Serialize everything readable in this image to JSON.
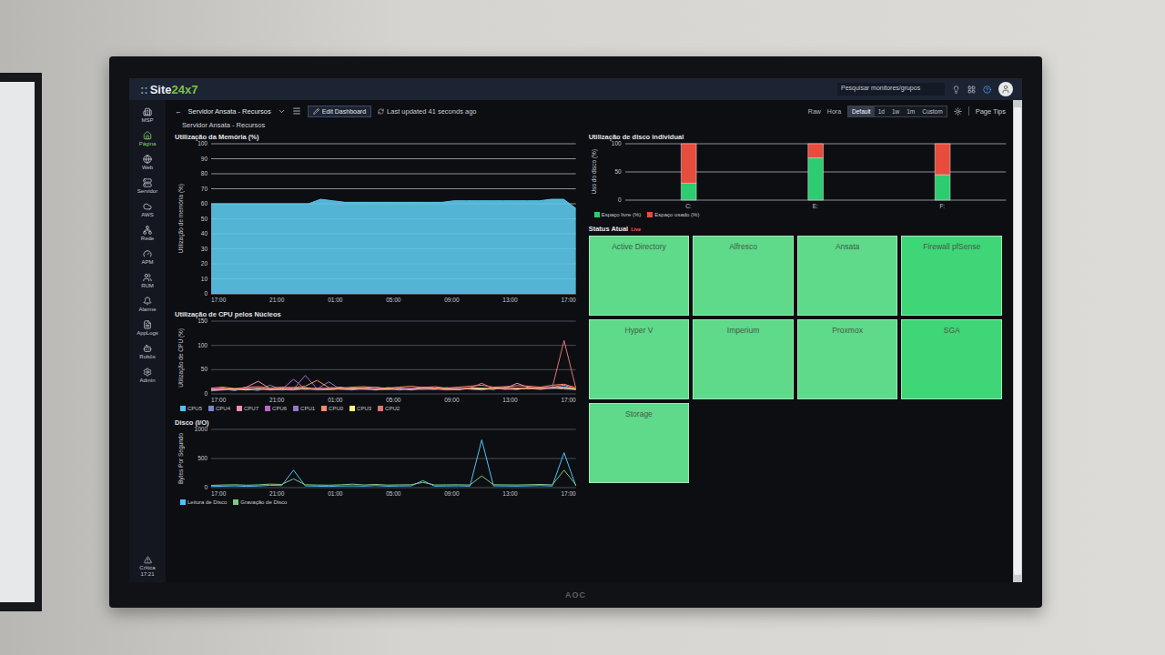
{
  "monitor": {
    "brand": "AOC"
  },
  "topbar": {
    "logo_mark": "::",
    "logo_prefix": "Site",
    "logo_suffix": "24x7",
    "search": {
      "placeholder": "Pesquisar monitores/grupos"
    }
  },
  "sidebar": {
    "items": [
      {
        "label": "MSP",
        "selected": false
      },
      {
        "label": "Página",
        "selected": true
      },
      {
        "label": "Web",
        "selected": false
      },
      {
        "label": "Servidor",
        "selected": false
      },
      {
        "label": "AWS",
        "selected": false
      },
      {
        "label": "Rede",
        "selected": false
      },
      {
        "label": "APM",
        "selected": false
      },
      {
        "label": "RUM",
        "selected": false
      },
      {
        "label": "Alarme",
        "selected": false
      },
      {
        "label": "AppLogs",
        "selected": false
      },
      {
        "label": "Robôs",
        "selected": false
      },
      {
        "label": "Admin",
        "selected": false
      }
    ],
    "footer": {
      "label": "Crítica",
      "time": "17:21"
    }
  },
  "dashboard": {
    "back": "←",
    "title": "Servidor Ansata - Recursos",
    "subtitle": "Servidor Ansata - Recursos",
    "edit_button": "Edit Dashboard",
    "last_updated": "Last updated 41 seconds ago",
    "modes": [
      {
        "label": "Raw",
        "selected": false
      },
      {
        "label": "Hora",
        "selected": false
      }
    ],
    "ranges": [
      {
        "label": "Default",
        "selected": true
      },
      {
        "label": "1d",
        "selected": false
      },
      {
        "label": "1w",
        "selected": false
      },
      {
        "label": "1m",
        "selected": false
      },
      {
        "label": "Custom",
        "selected": false
      }
    ],
    "page_tips": "Page Tips"
  },
  "memory_chart": {
    "title": "Utilização da Memória (%)",
    "y_label": "Utilização de memória (%)",
    "y_ticks": [
      "0",
      "10",
      "20",
      "30",
      "40",
      "50",
      "60",
      "70",
      "80",
      "90",
      "100"
    ],
    "x_ticks": [
      "17:00",
      "21:00",
      "01:00",
      "05:00",
      "09:00",
      "13:00",
      "17:00"
    ],
    "series": [
      {
        "color": "#5cc6ea",
        "values": [
          60,
          60,
          60,
          60,
          60,
          60,
          60,
          60,
          60,
          63,
          62,
          61,
          61,
          61,
          61,
          61,
          61,
          61,
          61,
          61,
          62,
          62,
          62,
          62,
          62,
          62,
          62,
          62,
          63,
          63,
          57
        ]
      }
    ]
  },
  "cpu_chart": {
    "title": "Utilização de CPU pelos Núcleos",
    "y_label": "Utilização de CPU (%)",
    "y_ticks": [
      "0",
      "50",
      "100",
      "150"
    ],
    "x_ticks": [
      "17:00",
      "21:00",
      "01:00",
      "05:00",
      "09:00",
      "13:00",
      "17:00"
    ],
    "series": [
      {
        "name": "CPU5",
        "color": "#4fc3f7",
        "values": [
          8,
          10,
          7,
          12,
          9,
          11,
          8,
          10,
          13,
          9,
          12,
          10,
          9,
          11,
          14,
          10,
          8,
          12,
          11,
          9,
          13,
          10,
          12,
          11,
          9,
          14,
          12,
          10,
          13,
          11,
          15,
          9
        ]
      },
      {
        "name": "CPU4",
        "color": "#7986cb",
        "values": [
          6,
          9,
          8,
          10,
          7,
          18,
          9,
          8,
          11,
          10,
          25,
          9,
          8,
          12,
          10,
          9,
          11,
          8,
          10,
          12,
          9,
          11,
          10,
          8,
          12,
          11,
          9,
          13,
          10,
          12,
          14,
          8
        ]
      },
      {
        "name": "CPU7",
        "color": "#f48fb1",
        "values": [
          10,
          12,
          9,
          14,
          26,
          11,
          10,
          13,
          9,
          12,
          11,
          14,
          10,
          12,
          9,
          13,
          11,
          10,
          14,
          12,
          11,
          9,
          13,
          12,
          10,
          11,
          22,
          13,
          12,
          14,
          18,
          10
        ]
      },
      {
        "name": "CPU6",
        "color": "#ba68c8",
        "values": [
          7,
          8,
          10,
          9,
          11,
          8,
          9,
          30,
          10,
          8,
          9,
          11,
          10,
          9,
          8,
          10,
          12,
          9,
          11,
          10,
          8,
          9,
          11,
          10,
          12,
          9,
          10,
          11,
          9,
          12,
          10,
          9
        ]
      },
      {
        "name": "CPU1",
        "color": "#9575cd",
        "values": [
          9,
          11,
          8,
          10,
          12,
          9,
          11,
          10,
          38,
          11,
          9,
          10,
          12,
          11,
          9,
          10,
          11,
          12,
          9,
          10,
          11,
          12,
          10,
          9,
          11,
          12,
          10,
          11,
          12,
          13,
          11,
          10
        ]
      },
      {
        "name": "CPU0",
        "color": "#ff8a65",
        "values": [
          12,
          14,
          11,
          13,
          15,
          12,
          14,
          13,
          16,
          28,
          13,
          12,
          14,
          15,
          13,
          12,
          14,
          16,
          13,
          15,
          12,
          14,
          16,
          18,
          14,
          15,
          17,
          16,
          14,
          18,
          20,
          13
        ]
      },
      {
        "name": "CPU3",
        "color": "#fff176",
        "values": [
          8,
          9,
          10,
          8,
          11,
          9,
          10,
          9,
          12,
          10,
          9,
          11,
          10,
          12,
          9,
          11,
          10,
          9,
          12,
          11,
          10,
          9,
          11,
          10,
          12,
          11,
          10,
          12,
          11,
          13,
          12,
          10
        ]
      },
      {
        "name": "CPU2",
        "color": "#e57373",
        "values": [
          9,
          10,
          8,
          11,
          9,
          10,
          12,
          9,
          10,
          11,
          9,
          10,
          12,
          11,
          10,
          9,
          11,
          10,
          12,
          11,
          9,
          10,
          12,
          22,
          11,
          10,
          12,
          11,
          10,
          13,
          110,
          12
        ]
      }
    ]
  },
  "disk_io_chart": {
    "title": "Disco (I/O)",
    "y_label": "Bytes Por Segundo",
    "y_ticks": [
      "0",
      "500",
      "1000"
    ],
    "x_ticks": [
      "17:00",
      "21:00",
      "01:00",
      "05:00",
      "09:00",
      "13:00",
      "17:00"
    ],
    "series": [
      {
        "name": "Leitura de Disco",
        "color": "#4fc3f7",
        "values": [
          20,
          25,
          30,
          22,
          28,
          40,
          35,
          300,
          30,
          25,
          22,
          28,
          30,
          26,
          35,
          24,
          28,
          30,
          120,
          26,
          28,
          30,
          25,
          820,
          30,
          28,
          26,
          30,
          35,
          28,
          600,
          30
        ]
      },
      {
        "name": "Gravação de Disco",
        "color": "#81c784",
        "values": [
          40,
          45,
          50,
          42,
          48,
          60,
          55,
          150,
          50,
          45,
          42,
          48,
          60,
          46,
          55,
          44,
          48,
          50,
          90,
          46,
          48,
          50,
          45,
          200,
          50,
          48,
          46,
          50,
          55,
          48,
          300,
          50
        ]
      }
    ]
  },
  "disk_usage_chart": {
    "title": "Utilização de disco individual",
    "y_label": "Uso do disco (%)",
    "y_ticks": [
      "0",
      "50",
      "100"
    ],
    "x_labels": [
      "C:",
      "E:",
      "F:"
    ],
    "series": [
      {
        "name": "Espaço livre (%)",
        "color": "#2ecc71",
        "values": [
          30,
          75,
          45
        ]
      },
      {
        "name": "Espaço usado (%)",
        "color": "#e74c3c",
        "values": [
          70,
          25,
          55
        ]
      }
    ]
  },
  "status": {
    "title": "Status Atual",
    "badge": "Live",
    "tiles": [
      {
        "label": "Active Directory",
        "color": "#5fd98a"
      },
      {
        "label": "Alfresco",
        "color": "#5fd98a"
      },
      {
        "label": "Ansata",
        "color": "#5fd98a"
      },
      {
        "label": "Firewall pfSense",
        "color": "#3fd677"
      },
      {
        "label": "Hyper V",
        "color": "#5fd98a"
      },
      {
        "label": "Imperium",
        "color": "#5fd98a"
      },
      {
        "label": "Proxmox",
        "color": "#5fd98a"
      },
      {
        "label": "SGA",
        "color": "#3fd677"
      },
      {
        "label": "Storage",
        "color": "#5fd98a"
      }
    ]
  }
}
